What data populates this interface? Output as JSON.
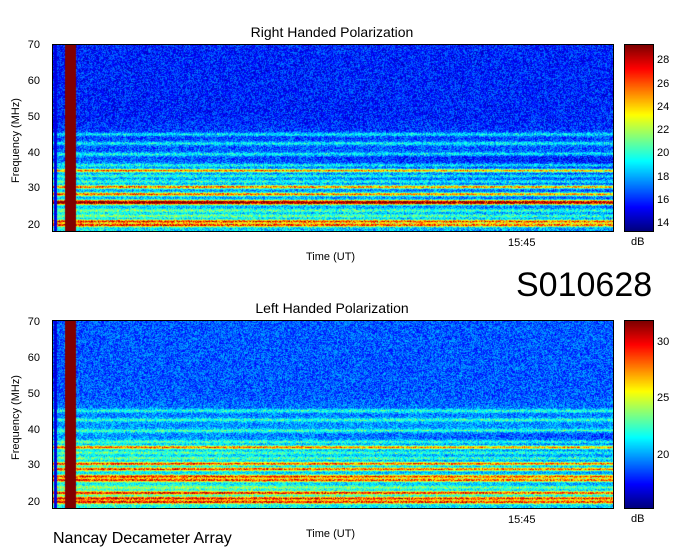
{
  "event_id": "S010628",
  "footer": "Nancay Decameter Array",
  "chart_data": [
    {
      "type": "heatmap",
      "title": "Right Handed Polarization",
      "xlabel": "Time (UT)",
      "ylabel": "Frequency (MHz)",
      "x_ticks": [
        "15:45"
      ],
      "y_ticks": [
        20,
        30,
        40,
        50,
        60,
        70
      ],
      "ylim": [
        19,
        70
      ],
      "colorbar": {
        "unit": "dB",
        "ticks": [
          14,
          16,
          18,
          20,
          22,
          24,
          26,
          28
        ],
        "range": [
          13.5,
          29.5
        ]
      },
      "background_level_db": 16,
      "strong_bands_mhz": [
        20.5,
        21.5,
        26.5,
        27,
        29,
        31,
        35.5
      ],
      "moderate_bands_mhz": [
        23,
        24.5,
        32.5,
        34,
        37,
        40,
        43,
        45.5
      ],
      "colormap": "jet"
    },
    {
      "type": "heatmap",
      "title": "Left Handed Polarization",
      "xlabel": "Time (UT)",
      "ylabel": "Frequency (MHz)",
      "x_ticks": [
        "15:45"
      ],
      "y_ticks": [
        20,
        30,
        40,
        50,
        60,
        70
      ],
      "ylim": [
        19,
        70
      ],
      "colorbar": {
        "unit": "dB",
        "ticks": [
          20,
          25,
          30
        ],
        "range": [
          15.5,
          32
        ]
      },
      "background_level_db": 19,
      "strong_bands_mhz": [
        20.5,
        21.5,
        23,
        26.5,
        27.5,
        29.5,
        31,
        35.5
      ],
      "moderate_bands_mhz": [
        24.5,
        32.5,
        34,
        37,
        40,
        43,
        45.5
      ],
      "colormap": "jet"
    }
  ]
}
